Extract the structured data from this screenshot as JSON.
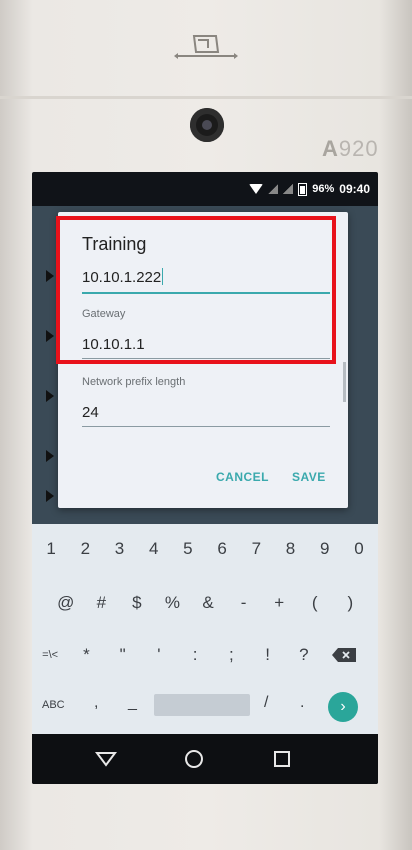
{
  "device": {
    "model_prefix": "A",
    "model_number": "920"
  },
  "status_bar": {
    "battery": "96%",
    "time": "09:40"
  },
  "dialog": {
    "title": "Training",
    "ip_value": "10.10.1.222",
    "gateway_label": "Gateway",
    "gateway_value": "10.10.1.1",
    "prefix_label": "Network prefix length",
    "prefix_value": "24",
    "cancel_label": "CANCEL",
    "save_label": "SAVE"
  },
  "keyboard": {
    "row1": [
      "1",
      "2",
      "3",
      "4",
      "5",
      "6",
      "7",
      "8",
      "9",
      "0"
    ],
    "row2": [
      "@",
      "#",
      "$",
      "%",
      "&",
      "-",
      "+",
      "(",
      ")"
    ],
    "row3": [
      "=\\<",
      "*",
      "\"",
      "'",
      ":",
      ";",
      "!",
      "?"
    ],
    "abc_label": "ABC",
    "row5_left": [
      ",",
      "_"
    ],
    "row5_right": [
      "/",
      "."
    ],
    "go_icon": "›"
  },
  "colors": {
    "accent": "#3aa9ad",
    "highlight": "#e8121b",
    "go_button": "#2aa69a"
  }
}
